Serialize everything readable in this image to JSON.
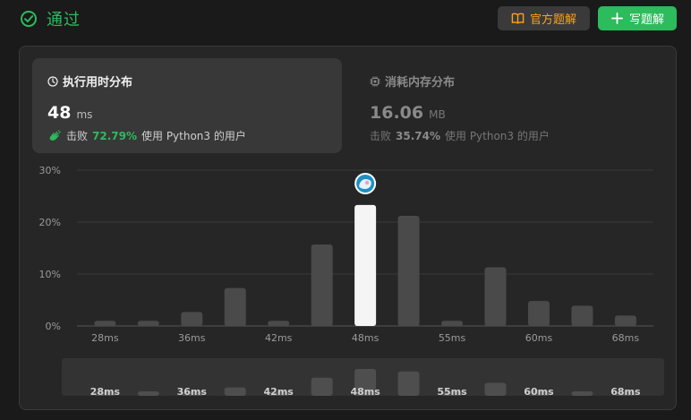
{
  "header": {
    "status": "通过",
    "solution_button": "官方题解",
    "write_button": "写题解"
  },
  "runtime": {
    "title": "执行用时分布",
    "value": "48",
    "unit": "ms",
    "beats_label": "击败",
    "beats_pct": "72.79%",
    "beats_suffix": "使用 Python3 的用户"
  },
  "memory": {
    "title": "消耗内存分布",
    "value": "16.06",
    "unit": "MB",
    "beats_label": "击败",
    "beats_pct": "35.74%",
    "beats_suffix": "使用 Python3 的用户"
  },
  "colors": {
    "accent_green": "#2cbb5d",
    "accent_orange": "#ffa116",
    "bar": "#4a4a4a",
    "bar_highlight": "#f5f5f5"
  },
  "chart_data": {
    "type": "bar",
    "y_ticks": [
      "30%",
      "20%",
      "10%",
      "0%"
    ],
    "ylim": [
      0,
      30
    ],
    "grid": true,
    "x_tick_labels": [
      "28ms",
      "36ms",
      "42ms",
      "48ms",
      "55ms",
      "60ms",
      "68ms"
    ],
    "values": [
      1.0,
      1.0,
      2.7,
      7.3,
      1.0,
      15.7,
      23.3,
      21.2,
      1.0,
      11.3,
      4.8,
      3.9,
      2.0
    ],
    "highlight_index": 6,
    "marker_icon": "user-avatar-icon"
  },
  "navigator": {
    "x_tick_labels": [
      "28ms",
      "36ms",
      "42ms",
      "48ms",
      "55ms",
      "60ms",
      "68ms"
    ]
  }
}
